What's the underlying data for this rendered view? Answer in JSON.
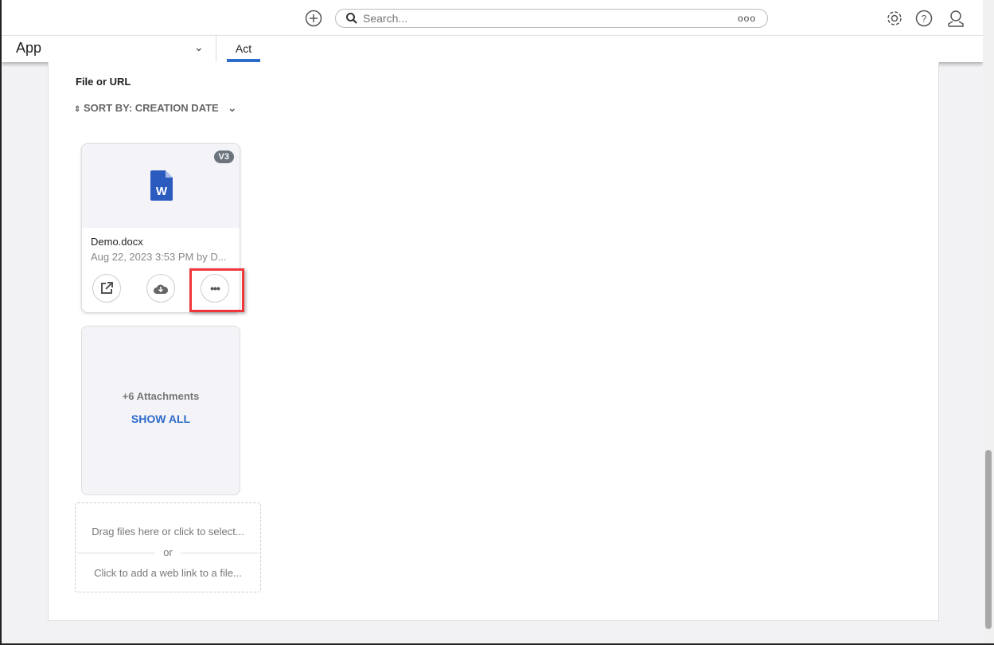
{
  "header": {
    "search_placeholder": "Search...",
    "search_options": "ooo",
    "icons": [
      "plus-circle-icon",
      "search-icon",
      "gear-icon",
      "help-icon",
      "user-icon"
    ]
  },
  "nav": {
    "app": "App",
    "tab": "Act"
  },
  "main": {
    "label": "File or URL",
    "sort": "SORT BY: CREATION DATE",
    "file": {
      "name": "Demo.docx",
      "meta": "Aug 22, 2023 3:53 PM by D...",
      "version": "V3",
      "type_letter": "W"
    },
    "more": {
      "count": "+6 Attachments",
      "show_all": "SHOW ALL"
    },
    "drop": {
      "files": "Drag files here or click to select...",
      "or": "or",
      "link": "Click to add a web link to a file..."
    }
  },
  "colors": {
    "accent": "#2d6bc9",
    "highlight": "#f0373c",
    "word": "#2b5bbf"
  }
}
